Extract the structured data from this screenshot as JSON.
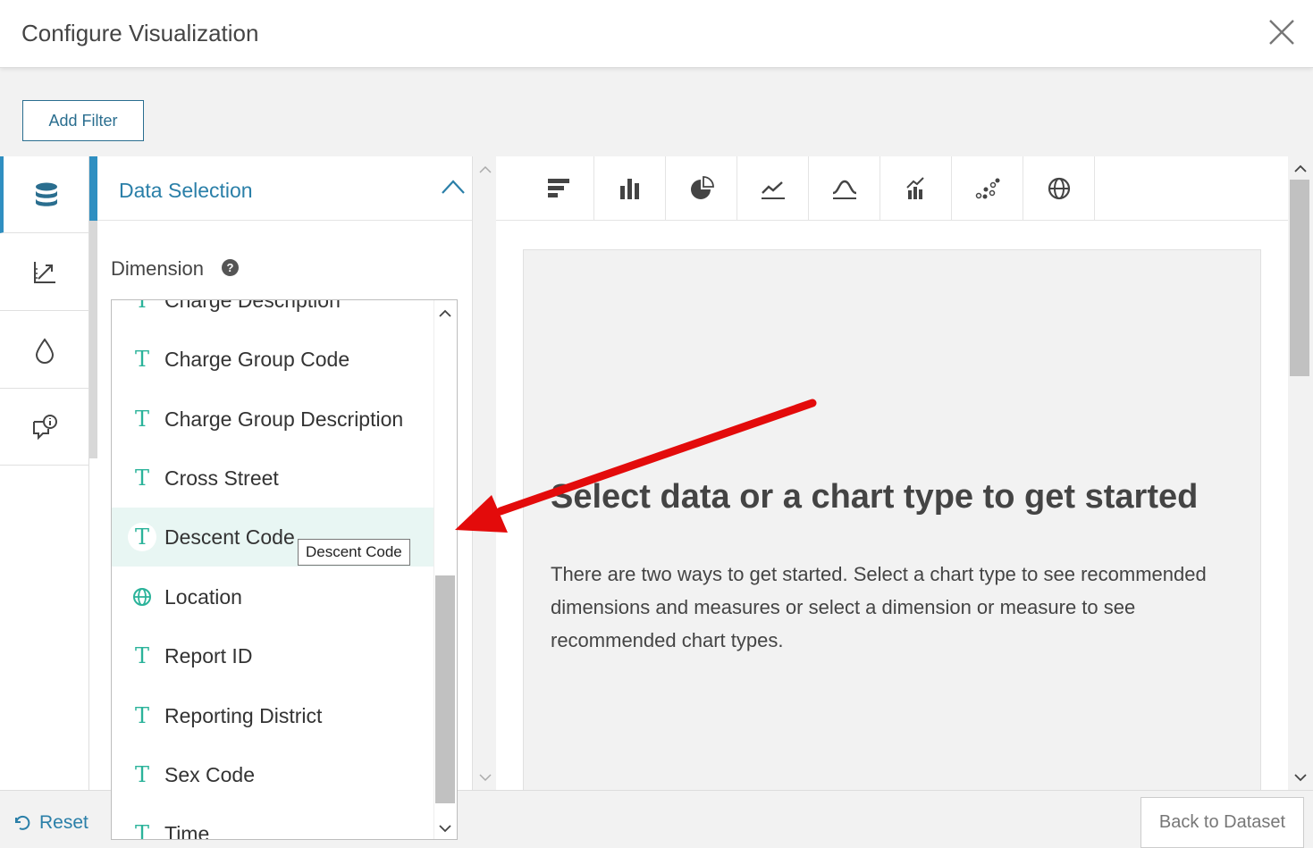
{
  "header": {
    "title": "Configure Visualization",
    "close_icon": "close-icon"
  },
  "toolbar": {
    "add_filter_label": "Add Filter"
  },
  "rail": {
    "items": [
      {
        "name": "data-icon",
        "active": true
      },
      {
        "name": "axis-chart-icon",
        "active": false
      },
      {
        "name": "color-drop-icon",
        "active": false
      },
      {
        "name": "info-comment-icon",
        "active": false
      }
    ]
  },
  "data_selection": {
    "title": "Data Selection",
    "dimension_label": "Dimension",
    "help": "?",
    "items": [
      {
        "label": "Charge Description",
        "type": "text"
      },
      {
        "label": "Charge Group Code",
        "type": "text"
      },
      {
        "label": "Charge Group Description",
        "type": "text"
      },
      {
        "label": "Cross Street",
        "type": "text"
      },
      {
        "label": "Descent Code",
        "type": "text"
      },
      {
        "label": "Location",
        "type": "location"
      },
      {
        "label": "Report ID",
        "type": "text"
      },
      {
        "label": "Reporting District",
        "type": "text"
      },
      {
        "label": "Sex Code",
        "type": "text"
      },
      {
        "label": "Time",
        "type": "text"
      }
    ],
    "text_type_glyph": "T",
    "tooltip": "Descent Code"
  },
  "chart_types": [
    "horizontal-bar-icon",
    "column-chart-icon",
    "pie-chart-icon",
    "line-chart-icon",
    "area-chart-icon",
    "combo-chart-icon",
    "scatter-chart-icon",
    "map-globe-icon"
  ],
  "placeholder": {
    "heading": "Select data or a chart type to get started",
    "body": "There are two ways to get started. Select a chart type to see recommended dimensions and measures or select a dimension or measure to see recommended chart types."
  },
  "footer": {
    "reset_label": "Reset",
    "back_label": "Back to Dataset"
  },
  "colors": {
    "accent": "#2a7fa8",
    "type_icon": "#2bb39a",
    "hover_row": "#e8f6f3",
    "annotation_arrow": "#e30b0b"
  }
}
